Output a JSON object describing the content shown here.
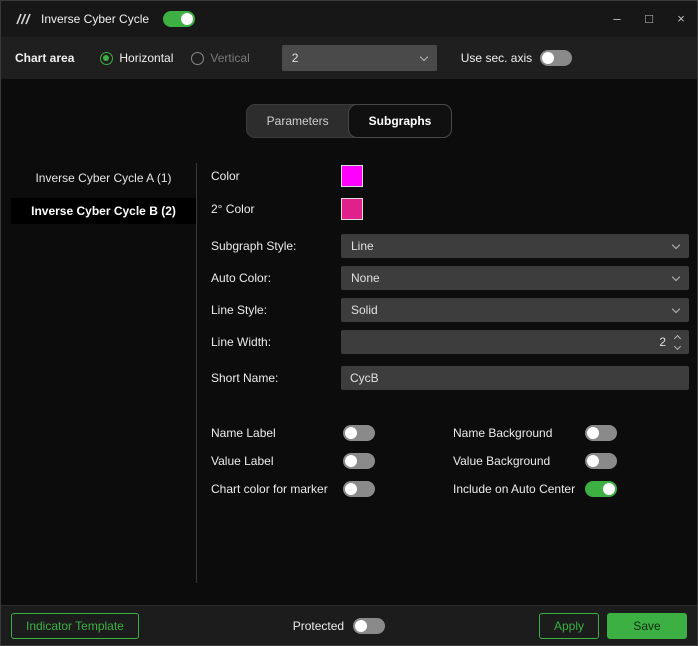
{
  "colors": {
    "accent": "#3CB043",
    "swatch1": "#FF00FF",
    "swatch2": "#E0218A"
  },
  "titlebar": {
    "title": "Inverse Cyber Cycle",
    "enabled_on": true,
    "minimize_glyph": "–",
    "maximize_glyph": "□",
    "close_glyph": "×"
  },
  "chartbar": {
    "label": "Chart area",
    "horizontal_label": "Horizontal",
    "horizontal_on": true,
    "vertical_label": "Vertical",
    "vertical_on": false,
    "chart_number": "2",
    "sec_axis_label": "Use sec. axis",
    "sec_axis_on": false
  },
  "tabs": [
    {
      "label": "Parameters",
      "active": false
    },
    {
      "label": "Subgraphs",
      "active": true
    }
  ],
  "list": {
    "items": [
      {
        "label": "Inverse Cyber Cycle A (1)",
        "selected": false
      },
      {
        "label": "Inverse Cyber Cycle B (2)",
        "selected": true
      }
    ]
  },
  "form": {
    "color_label": "Color",
    "color2_label": "2° Color",
    "subgraph_style_label": "Subgraph Style:",
    "subgraph_style_value": "Line",
    "auto_color_label": "Auto Color:",
    "auto_color_value": "None",
    "line_style_label": "Line Style:",
    "line_style_value": "Solid",
    "line_width_label": "Line Width:",
    "line_width_value": "2",
    "short_name_label": "Short Name:",
    "short_name_value": "CycB"
  },
  "options": {
    "left": [
      {
        "label": "Name Label",
        "on": false
      },
      {
        "label": "Value Label",
        "on": false
      },
      {
        "label": "Chart color for marker",
        "on": false
      }
    ],
    "right": [
      {
        "label": "Name Background",
        "on": false
      },
      {
        "label": "Value Background",
        "on": false
      },
      {
        "label": "Include on Auto Center",
        "on": true
      }
    ]
  },
  "footer": {
    "indicator_template": "Indicator Template",
    "protected_label": "Protected",
    "protected_on": false,
    "apply": "Apply",
    "save": "Save"
  }
}
